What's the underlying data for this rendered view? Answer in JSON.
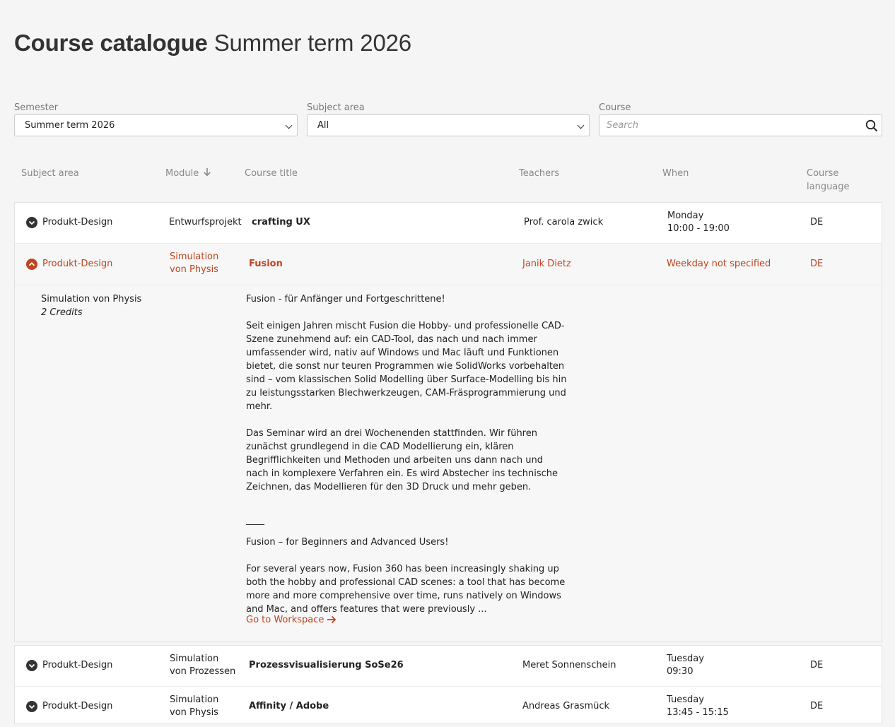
{
  "header": {
    "title_bold": "Course catalogue",
    "title_rest": "Summer term 2026"
  },
  "filters": {
    "semester": {
      "label": "Semester",
      "value": "Summer term 2026"
    },
    "subject": {
      "label": "Subject area",
      "value": "All"
    },
    "course": {
      "label": "Course",
      "placeholder": "Search"
    }
  },
  "columns": {
    "subject": "Subject area",
    "module": "Module",
    "title": "Course title",
    "teachers": "Teachers",
    "when": "When",
    "language_1": "Course",
    "language_2": "language"
  },
  "colors": {
    "accent": "#c0441f",
    "background": "#f5f5f5"
  },
  "courses": [
    {
      "subject": "Produkt-Design",
      "module_1": "Entwurfsprojekt",
      "module_2": "",
      "title": "crafting UX",
      "teacher": "Prof. carola zwick",
      "when_1": "Monday",
      "when_2": "10:00 - 19:00",
      "lang": "DE",
      "expanded": false
    },
    {
      "subject": "Produkt-Design",
      "module_1": "Simulation",
      "module_2": "von Physis",
      "title": "Fusion",
      "teacher": "Janik Dietz",
      "when_1": "Weekday not specified",
      "when_2": "",
      "lang": "DE",
      "expanded": true
    },
    {
      "subject": "Produkt-Design",
      "module_1": "Simulation",
      "module_2": "von Prozessen",
      "title": "Prozessvisualisierung SoSe26",
      "teacher": "Meret Sonnenschein",
      "when_1": "Tuesday",
      "when_2": "09:30",
      "lang": "DE",
      "expanded": false
    },
    {
      "subject": "Produkt-Design",
      "module_1": "Simulation",
      "module_2": "von Physis",
      "title": "Affinity / Adobe",
      "teacher": "Andreas Grasmück",
      "when_1": "Tuesday",
      "when_2": "13:45 - 15:15",
      "lang": "DE",
      "expanded": false
    }
  ],
  "detail": {
    "module": "Simulation von Physis",
    "credits": "2 Credits",
    "paragraphs": [
      "Fusion - für Anfänger und Fortgeschrittene!",
      "Seit einigen Jahren mischt Fusion die Hobby- und professionelle CAD-Szene zunehmend auf: ein CAD-Tool, das nach und nach immer umfassender wird, nativ auf Windows und Mac läuft und Funktionen bietet, die sonst nur teuren Programmen wie SolidWorks vorbehalten sind – vom klassischen Solid Modelling über Surface-Modelling bis hin zu leistungsstarken Blechwerkzeugen, CAM-Fräsprogrammierung und mehr.",
      "Das Seminar wird an drei Wochenenden stattfinden. Wir führen zunächst grundlegend in die CAD Modellierung ein, klären Begrifflichkeiten und Methoden und arbeiten uns dann nach und nach in komplexere Verfahren ein. Es wird Abstecher ins technische Zeichnen, das Modellieren für den 3D Druck und mehr geben."
    ],
    "separator": "____",
    "paragraphs_en": [
      "Fusion – for Beginners and Advanced Users!",
      "For several years now, Fusion 360 has been increasingly shaking up both the hobby and professional CAD scenes: a tool that has become more and more comprehensive over time, runs natively on Windows and Mac, and offers features that were previously ..."
    ],
    "link": "Go to Workspace"
  }
}
